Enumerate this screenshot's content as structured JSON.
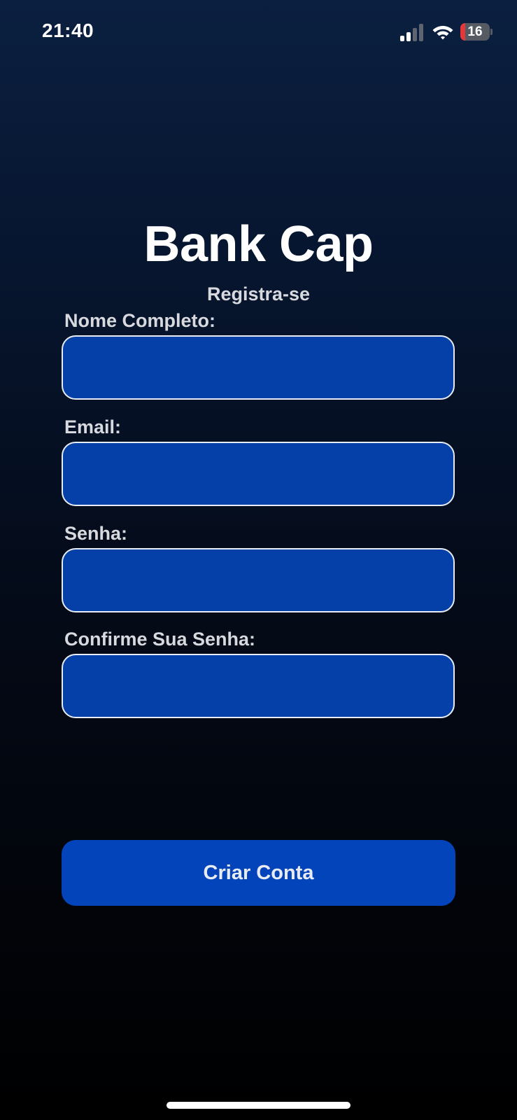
{
  "status_bar": {
    "time": "21:40",
    "battery_level": "16",
    "battery_fraction": 0.16,
    "signal_bars_active": 2,
    "signal_bars_total": 4,
    "icons": [
      "signal-icon",
      "wifi-icon",
      "battery-icon"
    ]
  },
  "header": {
    "title": "Bank Cap",
    "subtitle": "Registra-se"
  },
  "form": {
    "fields": [
      {
        "label": "Nome Completo:",
        "value": "",
        "placeholder": "",
        "type": "text"
      },
      {
        "label": "Email:",
        "value": "",
        "placeholder": "",
        "type": "email"
      },
      {
        "label": "Senha:",
        "value": "",
        "placeholder": "",
        "type": "password"
      },
      {
        "label": "Confirme Sua Senha:",
        "value": "",
        "placeholder": "",
        "type": "password"
      }
    ],
    "submit_label": "Criar Conta"
  },
  "colors": {
    "background_top": "#0b1f40",
    "background_bottom": "#000000",
    "input_fill": "#0540a8",
    "input_border": "#e8ecf5",
    "button_fill": "#0444bb",
    "battery_low": "#e5383b"
  }
}
